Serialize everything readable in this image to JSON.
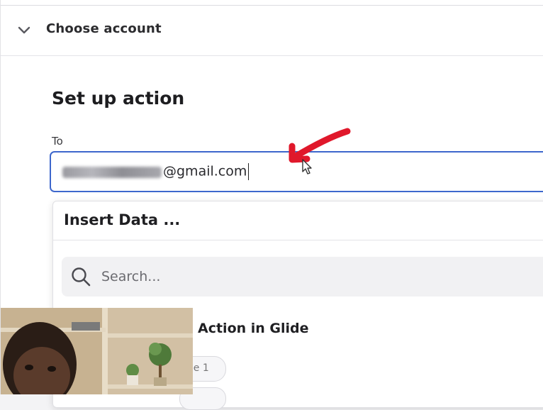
{
  "section": {
    "title": "Choose account",
    "chevron_icon": "chevron-down-icon"
  },
  "main": {
    "title": "Set up action",
    "to_label": "To",
    "to_value": "@gmail.com"
  },
  "dropdown": {
    "title": "Insert Data ...",
    "search_placeholder": "Search...",
    "item_title": "Action in Glide",
    "pill_text": "lue 1"
  },
  "colors": {
    "accent": "#3d67cc",
    "annotation": "#e0182b"
  }
}
